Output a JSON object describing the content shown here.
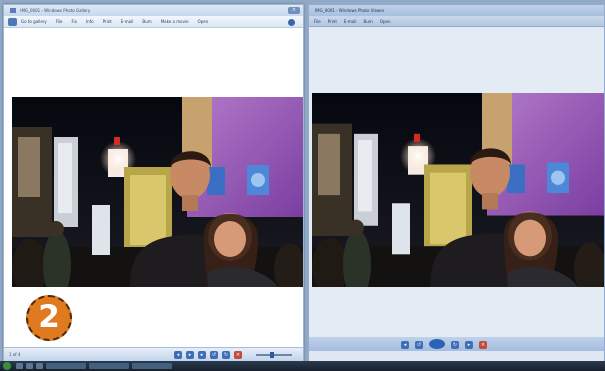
{
  "left_window": {
    "title": "IMG_0001 - Windows Photo Gallery",
    "menu": [
      "File",
      "Fix",
      "Info",
      "Print",
      "E-mail",
      "Burn",
      "Make a movie",
      "Open"
    ],
    "menu_first": "Go to gallery",
    "page_count": "1 of 4"
  },
  "right_window": {
    "title": "IMG_0001 - Windows Photo Viewer",
    "menu": [
      "File",
      "Print",
      "E-mail",
      "Burn",
      "Open"
    ]
  },
  "step_badge": "2",
  "taskbar": {
    "clock": ""
  },
  "colors": {
    "badge": "#e07a1f",
    "window_frame": "#9eb4cf",
    "taskbar": "#1c2838"
  },
  "icons": [
    "back-arrow-icon",
    "help-icon",
    "close-icon",
    "previous-icon",
    "play-icon",
    "next-icon",
    "rotate-left-icon",
    "rotate-right-icon",
    "delete-icon",
    "zoom-slider-icon",
    "start-orb-icon"
  ]
}
